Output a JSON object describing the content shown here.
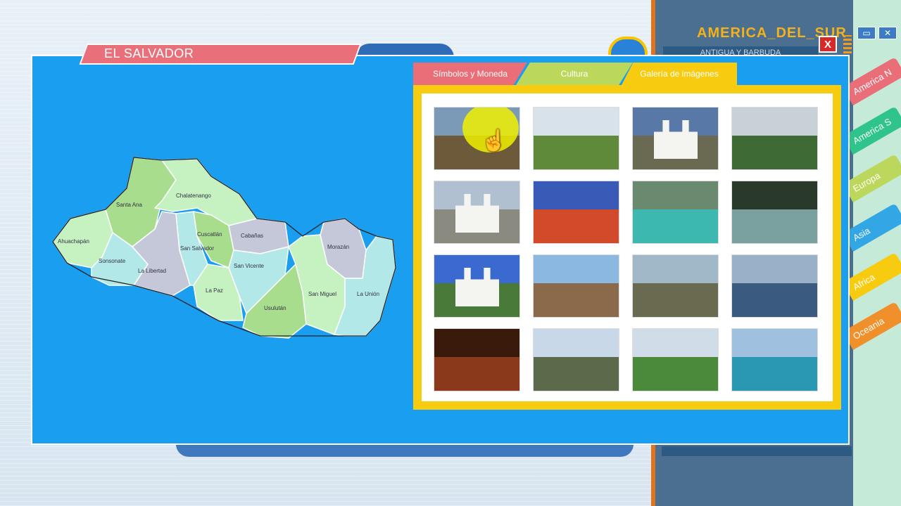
{
  "background": {
    "region_title": "AMERICA_DEL_SUR",
    "region_sub": "ANTIGUA Y BARBUDA"
  },
  "sidebar_tabs": [
    {
      "label": "America N",
      "color": "#e96e78"
    },
    {
      "label": "America S",
      "color": "#2fc489"
    },
    {
      "label": "Europa",
      "color": "#bcd85c"
    },
    {
      "label": "Asia",
      "color": "#33a7e6"
    },
    {
      "label": "Africa",
      "color": "#f7cc10"
    },
    {
      "label": "Oceania",
      "color": "#f0902a"
    }
  ],
  "window_buttons": {
    "restore": "▭",
    "close": "✕"
  },
  "modal": {
    "country": "EL SALVADOR",
    "close_label": "X"
  },
  "map": {
    "departments": [
      "Ahuachapán",
      "Santa Ana",
      "Chalatenango",
      "Sonsonate",
      "La Libertad",
      "San Salvador",
      "Cuscatlán",
      "Cabañas",
      "Morazán",
      "La Paz",
      "San Vicente",
      "San Miguel",
      "Usulután",
      "La Unión"
    ]
  },
  "panel": {
    "tabs": [
      "Símbolos y Moneda",
      "Cultura",
      "Galería de imágenes"
    ],
    "active_tab": "Galería de imágenes"
  },
  "gallery": {
    "thumbnails": [
      "colonial-street",
      "cobblestone-road",
      "white-church-palms",
      "green-hills",
      "white-colonial-church",
      "stained-glass-interior",
      "turquoise-lagoon",
      "waterfall",
      "white-church-blue-sky",
      "beach-rock",
      "cliff-rock",
      "lake-volcano",
      "theater-interior",
      "palm-trees-lake",
      "ruins-park",
      "colorful-boats"
    ]
  },
  "colors": {
    "modal_blue": "#1a9ef0",
    "country_tab": "#e96e78",
    "gallery_frame": "#f7cc10",
    "close_red": "#d92828"
  }
}
